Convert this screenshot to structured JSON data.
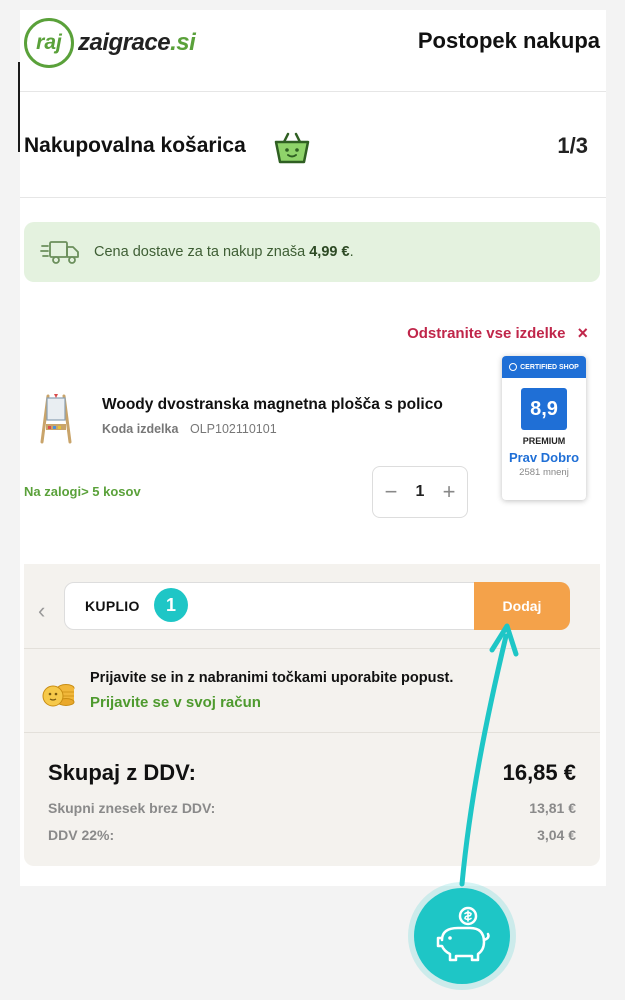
{
  "header": {
    "logo_mark": "raj",
    "logo_name": "zaigrace",
    "logo_tld": ".si",
    "title": "Postopek nakupa"
  },
  "cart": {
    "title": "Nakupovalna košarica",
    "step": "1/3"
  },
  "shipping": {
    "text_before": "Cena dostave za ta nakup znaša ",
    "price": "4,99 €",
    "text_after": "."
  },
  "remove_all": {
    "label": "Odstranite vse izdelke",
    "icon": "×"
  },
  "product": {
    "name": "Woody dvostranska magnetna plošča s polico",
    "code_label": "Koda izdelka",
    "code": "OLP102110101",
    "stock": "Na zalogi> 5 kosov",
    "quantity": "1",
    "minus": "−",
    "plus": "+"
  },
  "badge": {
    "header": "CERTIFIED SHOP",
    "score": "8,9",
    "level": "PREMIUM",
    "rating": "Prav Dobro",
    "reviews": "2581 mnenj"
  },
  "coupon": {
    "back": "‹",
    "value": "KUPLIO",
    "button": "Dodaj",
    "marker": "1"
  },
  "login": {
    "message": "Prijavite se in z nabranimi točkami uporabite popust.",
    "link": "Prijavite se v svoj račun"
  },
  "totals": {
    "total_label": "Skupaj z DDV:",
    "total_value": "16,85 €",
    "net_label": "Skupni znesek brez DDV:",
    "net_value": "13,81 €",
    "vat_label": "DDV 22%:",
    "vat_value": "3,04 €"
  },
  "colors": {
    "brand_green": "#5aa13a",
    "danger": "#c0264a",
    "accent_orange": "#f4a24a",
    "annotation_teal": "#1ec6c6"
  }
}
